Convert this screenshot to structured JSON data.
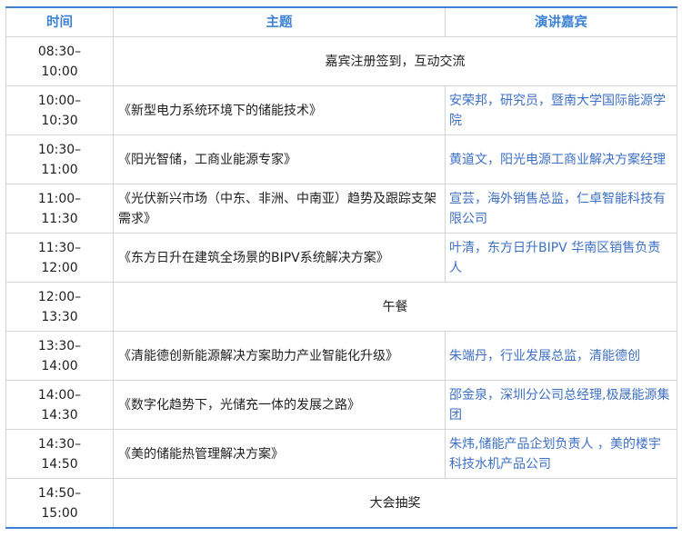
{
  "headers": {
    "time": "时间",
    "topic": "主题",
    "guest": "演讲嘉宾"
  },
  "rows": [
    {
      "time_start": "08:30–",
      "time_end": "10:00",
      "span_text": "嘉宾注册签到，互动交流"
    },
    {
      "time_start": "10:00–",
      "time_end": "10:30",
      "topic": "《新型电力系统环境下的储能技术》",
      "guest": "安荣邦，研究员，暨南大学国际能源学院"
    },
    {
      "time_start": "10:30–",
      "time_end": "11:00",
      "topic": "《阳光智储，工商业能源专家》",
      "guest": "黄道文，阳光电源工商业解决方案经理"
    },
    {
      "time_start": "11:00–",
      "time_end": "11:30",
      "topic": "《光伏新兴市场（中东、非洲、中南亚）趋势及跟踪支架需求》",
      "guest": "宣芸，海外销售总监，仁卓智能科技有限公司"
    },
    {
      "time_start": "11:30–",
      "time_end": "12:00",
      "topic": "《东方日升在建筑全场景的BIPV系统解决方案》",
      "guest": "叶清，东方日升BIPV 华南区销售负责人"
    },
    {
      "time_start": "12:00–",
      "time_end": "13:30",
      "span_text": "午餐"
    },
    {
      "time_start": "13:30–",
      "time_end": "14:00",
      "topic": "《清能德创新能源解决方案助力产业智能化升级》",
      "guest": "朱端丹，行业发展总监，清能德创"
    },
    {
      "time_start": "14:00–",
      "time_end": "14:30",
      "topic": "《数字化趋势下，光储充一体的发展之路》",
      "guest": "邵金泉，深圳分公司总经理,极晟能源集团"
    },
    {
      "time_start": "14:30–",
      "time_end": "14:50",
      "topic": "《美的储能热管理解决方案》",
      "guest": "朱炜,储能产品企划负责人 ，美的楼宇科技水机产品公司"
    },
    {
      "time_start": "14:50–",
      "time_end": "15:00",
      "span_text": "大会抽奖"
    }
  ]
}
